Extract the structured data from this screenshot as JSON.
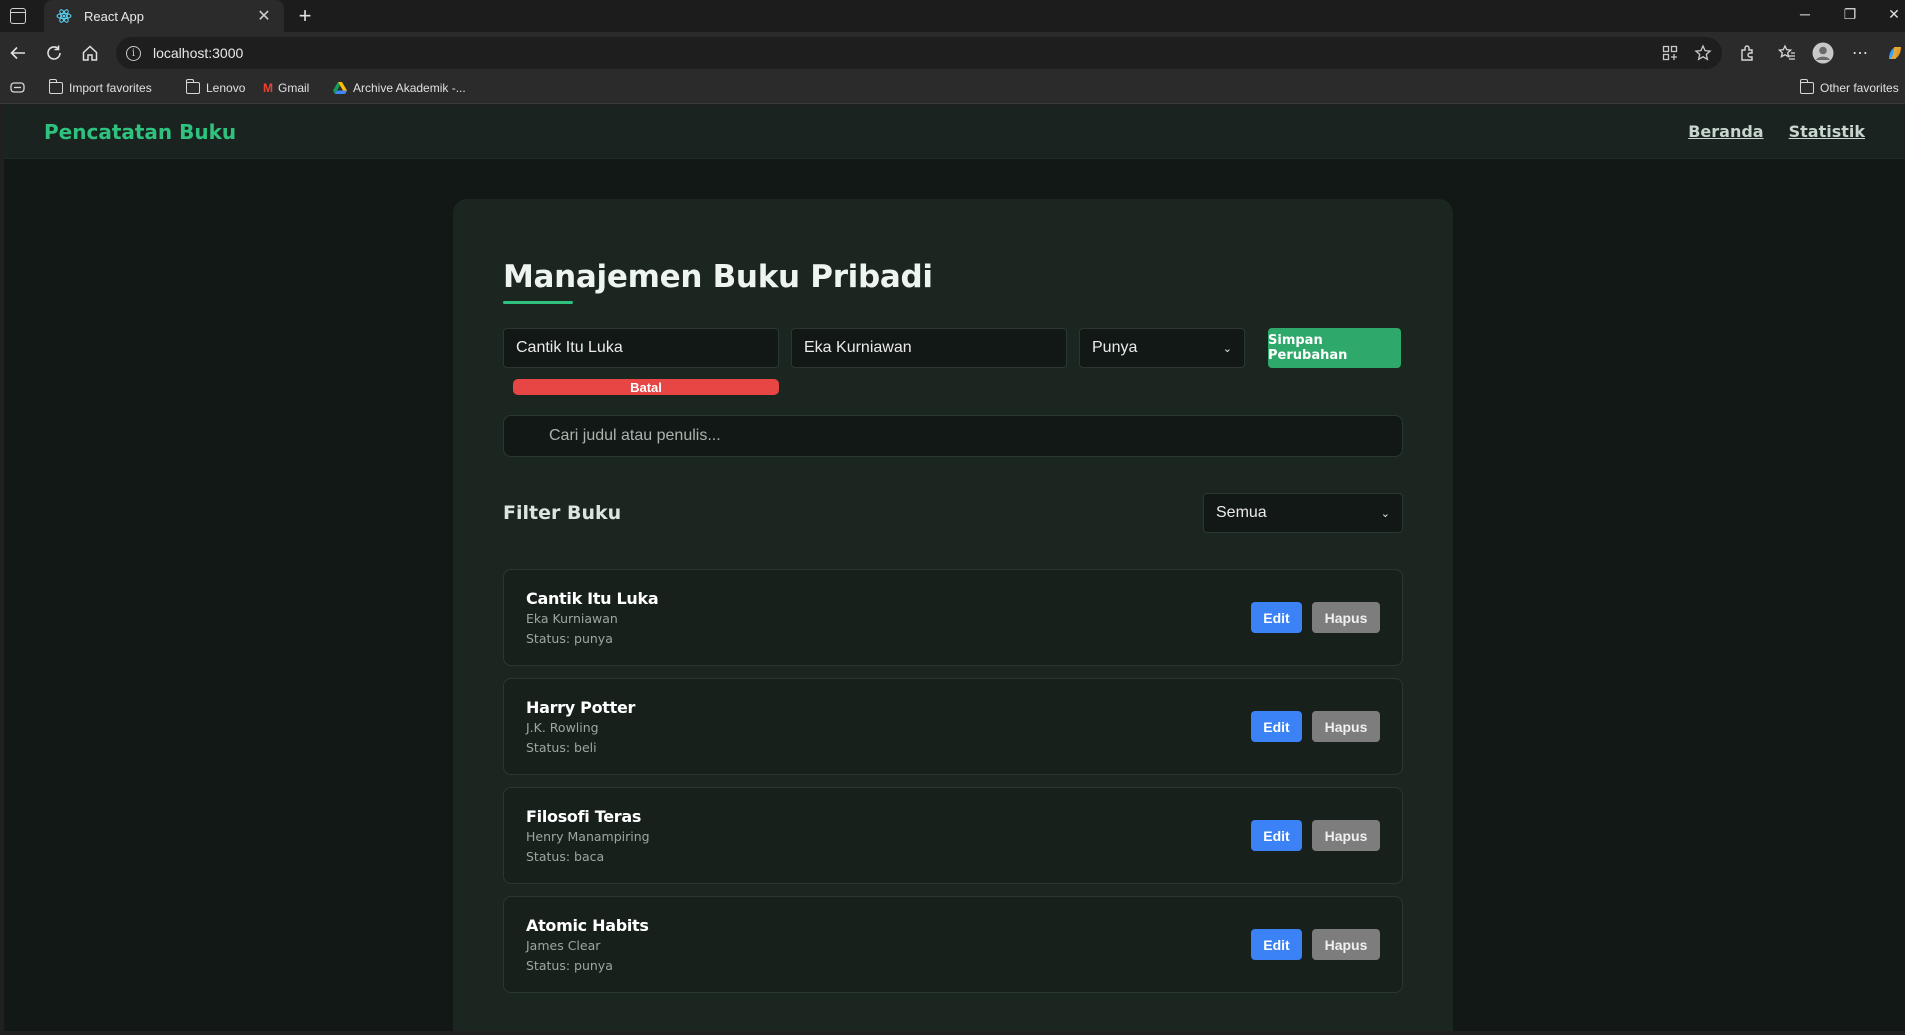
{
  "browser": {
    "tab_title": "React App",
    "url": "localhost:3000",
    "bookmarks": [
      "Import favorites",
      "Lenovo",
      "Gmail",
      "Archive Akademik -..."
    ],
    "other_favorites": "Other favorites"
  },
  "navbar": {
    "brand": "Pencatatan Buku",
    "links": [
      "Beranda",
      "Statistik"
    ]
  },
  "main": {
    "title": "Manajemen Buku Pribadi",
    "form": {
      "title_value": "Cantik Itu Luka",
      "author_value": "Eka Kurniawan",
      "status_selected": "Punya",
      "save_label": "Simpan Perubahan",
      "cancel_label": "Batal"
    },
    "search_placeholder": "Cari judul atau penulis...",
    "filter_title": "Filter Buku",
    "filter_selected": "Semua",
    "books": [
      {
        "title": "Cantik Itu Luka",
        "author": "Eka Kurniawan",
        "status": "Status: punya"
      },
      {
        "title": "Harry Potter",
        "author": "J.K. Rowling",
        "status": "Status: beli"
      },
      {
        "title": "Filosofi Teras",
        "author": "Henry Manampiring",
        "status": "Status: baca"
      },
      {
        "title": "Atomic Habits",
        "author": "James Clear",
        "status": "Status: punya"
      }
    ],
    "edit_label": "Edit",
    "delete_label": "Hapus"
  },
  "colors": {
    "accent": "#2ec27e",
    "edit": "#3b82f6",
    "cancel": "#e84545",
    "delete": "#7d7d7d"
  }
}
